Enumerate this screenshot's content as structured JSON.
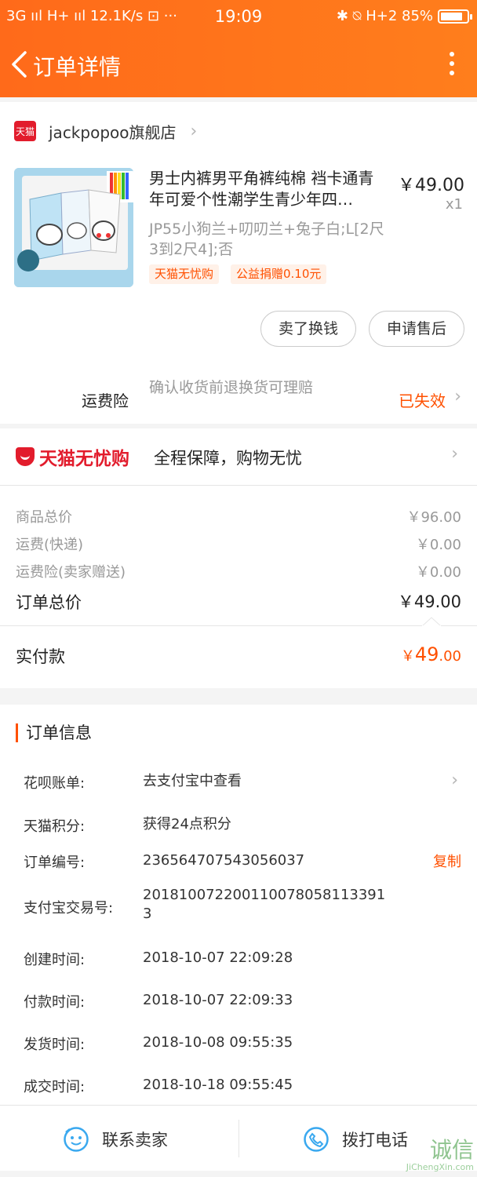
{
  "status_bar": {
    "left": "3G ııl H+ ııl 12.1K/s ⊡ ···",
    "time": "19:09",
    "right": "✱ ⍉ H+2 85%",
    "battery_level": 0.85
  },
  "nav": {
    "title": "订单详情"
  },
  "shop": {
    "logo_text": "天猫",
    "name": "jackpopoo旗舰店"
  },
  "product": {
    "title": "男士内裤男平角裤纯棉 裆卡通青年可爱个性潮学生青少年四…",
    "price": "￥49.00",
    "qty": "x1",
    "sku": "JP55小狗兰+叨叨兰+兔子白;L[2尺3到2尺4];否",
    "tags": [
      "天猫无忧购",
      "公益捐赠0.10元"
    ]
  },
  "actions": {
    "sell": "卖了换钱",
    "aftersale": "申请售后"
  },
  "insurance": {
    "label": "运费险",
    "desc": "确认收货前退换货可理赔",
    "status": "已失效"
  },
  "guarantee": {
    "logo": "天猫无忧购",
    "text": "全程保障，购物无忧"
  },
  "summary": {
    "rows": [
      {
        "label": "商品总价",
        "value": "￥96.00"
      },
      {
        "label": "运费(快递)",
        "value": "￥0.00"
      },
      {
        "label": "运费险(卖家赠送)",
        "value": "￥0.00"
      }
    ],
    "total_label": "订单总价",
    "total_value": "￥49.00",
    "paid_label": "实付款",
    "paid_currency": "￥",
    "paid_int": "49",
    "paid_dec": ".00"
  },
  "order_info": {
    "title": "订单信息",
    "rows": [
      {
        "label": "花呗账单:",
        "value": "去支付宝中查看"
      },
      {
        "label": "天猫积分:",
        "value": "获得24点积分"
      },
      {
        "label": "订单编号:",
        "value": "236564707543056037"
      },
      {
        "label": "支付宝交易号:",
        "value": "2018100722001100780581133913"
      },
      {
        "label": "创建时间:",
        "value": "2018-10-07 22:09:28"
      },
      {
        "label": "付款时间:",
        "value": "2018-10-07 22:09:33"
      },
      {
        "label": "发货时间:",
        "value": "2018-10-08 09:55:35"
      },
      {
        "label": "成交时间:",
        "value": "2018-10-18 09:55:45"
      }
    ],
    "copy_label": "复制"
  },
  "bottom_bar": {
    "contact": "联系卖家",
    "call": "拨打电话"
  },
  "watermark": {
    "cn": "诚信",
    "en": "JiChengXin.com"
  },
  "colors": {
    "accent": "#ff5000",
    "header": "#ff6a1a",
    "tmall_red": "#e21c2c",
    "icon_blue": "#39a8ef"
  }
}
